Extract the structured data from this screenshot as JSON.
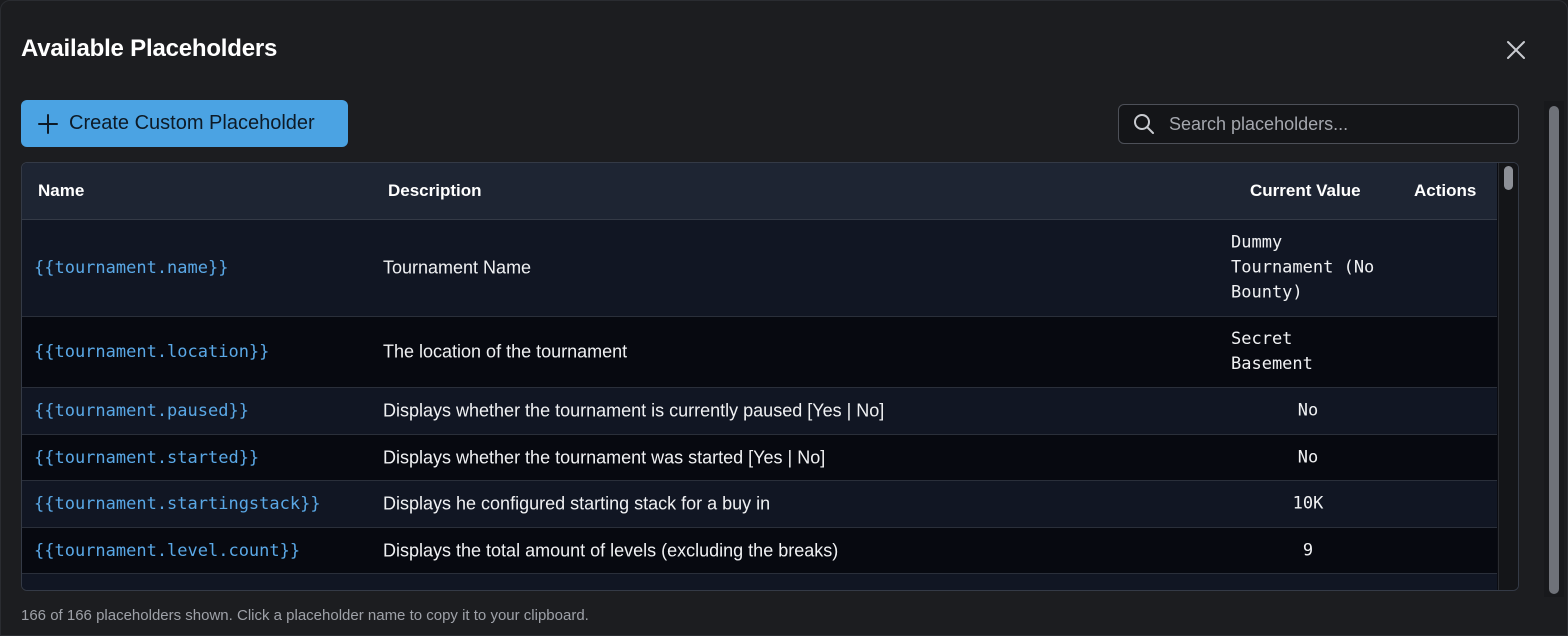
{
  "dialog": {
    "title": "Available Placeholders",
    "close_icon": "close-icon"
  },
  "toolbar": {
    "create_label": "Create Custom Placeholder",
    "create_icon": "plus-icon",
    "search_placeholder": "Search placeholders...",
    "search_value": "",
    "search_icon": "search-icon"
  },
  "table": {
    "columns": [
      "Name",
      "Description",
      "Current Value",
      "Actions"
    ],
    "rows": [
      {
        "name": "{{tournament.name}}",
        "description": "Tournament Name",
        "value": "Dummy Tournament (No Bounty)"
      },
      {
        "name": "{{tournament.location}}",
        "description": "The location of the tournament",
        "value": "Secret Basement"
      },
      {
        "name": "{{tournament.paused}}",
        "description": "Displays whether the tournament is currently paused [Yes | No]",
        "value": "No"
      },
      {
        "name": "{{tournament.started}}",
        "description": "Displays whether the tournament was started [Yes | No]",
        "value": "No"
      },
      {
        "name": "{{tournament.startingstack}}",
        "description": "Displays he configured starting stack for a buy in",
        "value": "10K"
      },
      {
        "name": "{{tournament.level.count}}",
        "description": "Displays the total amount of levels (excluding the breaks)",
        "value": "9"
      }
    ]
  },
  "footer": {
    "status": "166 of 166 placeholders shown. Click a placeholder name to copy it to your clipboard."
  },
  "colors": {
    "accent": "#4ba3e3",
    "link": "#5aa8e6",
    "background": "#1c1d20"
  }
}
